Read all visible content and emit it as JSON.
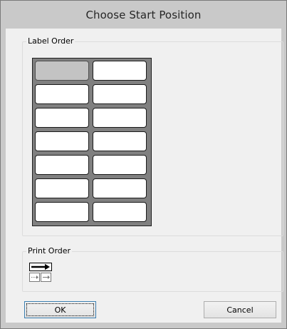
{
  "window": {
    "title": "Choose Start Position"
  },
  "label_order": {
    "legend": "Label Order",
    "rows": 7,
    "columns": 2,
    "selected_label": 1
  },
  "print_order": {
    "legend": "Print Order",
    "icon": "print-order-across-icon"
  },
  "buttons": {
    "ok_label": "OK",
    "cancel_label": "Cancel"
  },
  "colors": {
    "titlebar": "#c9c9c9",
    "sheet": "#808080",
    "selected_label": "#c3c3c3",
    "focus_border": "#3c7fb1"
  }
}
